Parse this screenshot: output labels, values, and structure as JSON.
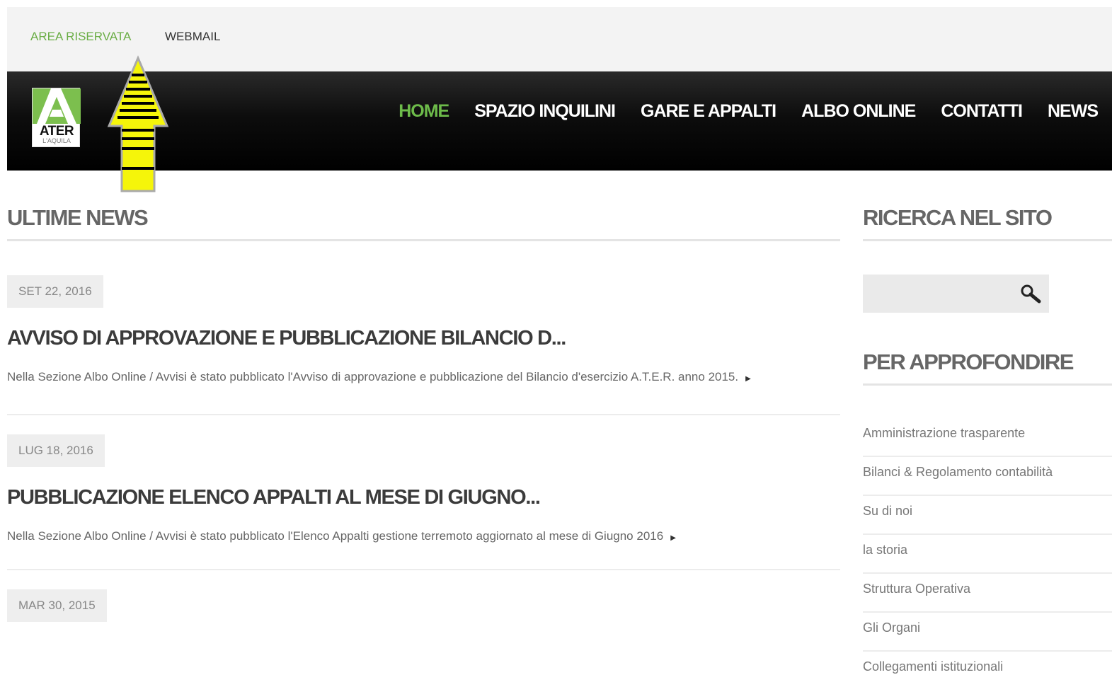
{
  "topbar": {
    "area_riservata": "AREA RISERVATA",
    "webmail": "WEBMAIL"
  },
  "logo": {
    "text": "ATER",
    "sub": "L'AQUILA"
  },
  "nav": [
    "HOME",
    "SPAZIO INQUILINI",
    "GARE E APPALTI",
    "ALBO ONLINE",
    "CONTATTI",
    "NEWS"
  ],
  "main": {
    "title": "ULTIME NEWS",
    "news": [
      {
        "date": "SET 22, 2016",
        "title": "AVVISO DI APPROVAZIONE E PUBBLICAZIONE BILANCIO D...",
        "text": "Nella Sezione Albo Online / Avvisi è stato pubblicato l'Avviso di approvazione e pubblicazione del Bilancio d'esercizio A.T.E.R. anno 2015."
      },
      {
        "date": "LUG 18, 2016",
        "title": "PUBBLICAZIONE ELENCO APPALTI AL MESE DI GIUGNO...",
        "text": "Nella Sezione Albo Online / Avvisi è stato pubblicato l'Elenco Appalti gestione terremoto aggiornato al mese di Giugno 2016"
      },
      {
        "date": "MAR 30, 2015"
      }
    ]
  },
  "sidebar": {
    "search_title": "RICERCA NEL SITO",
    "search_value": "",
    "links_title": "PER APPROFONDIRE",
    "links": [
      "Amministrazione trasparente",
      "Bilanci & Regolamento contabilità",
      "Su di noi",
      "la storia",
      "Struttura Operativa",
      "Gli Organi",
      "Collegamenti istituzionali"
    ]
  },
  "colors": {
    "accent_green": "#6dbb4a",
    "arrow_yellow": "#f5f50a",
    "navbar": "#000000"
  },
  "icons": {
    "arrow": "yellow-up-arrow-icon",
    "search": "magnifier-icon",
    "more": "triangle-right-icon"
  }
}
